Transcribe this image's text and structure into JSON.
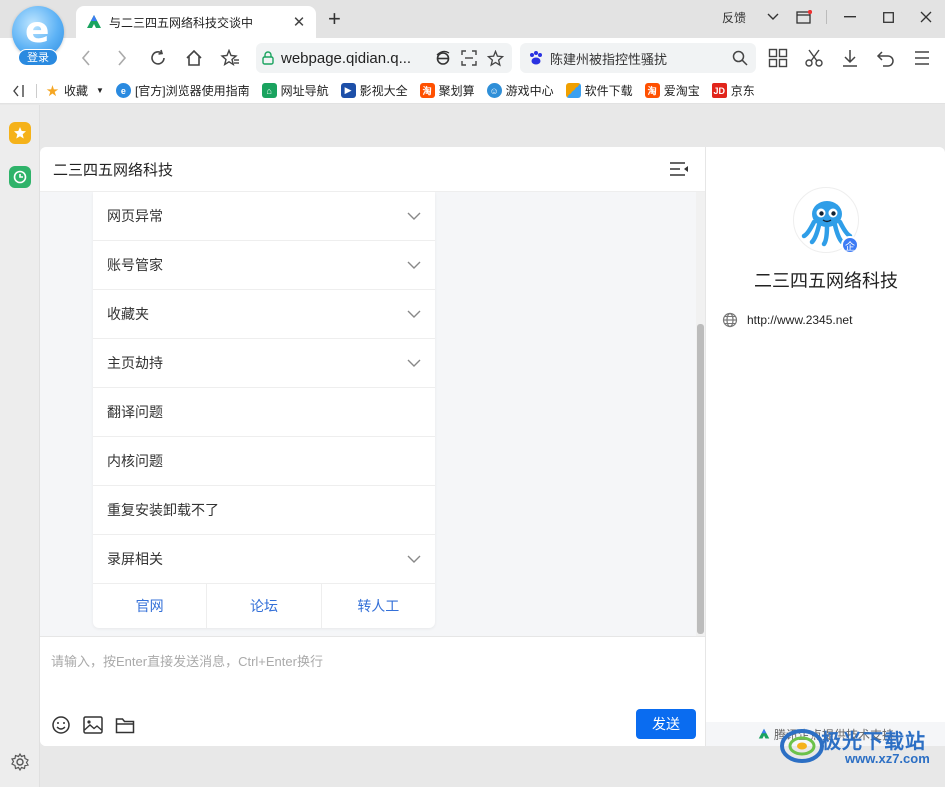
{
  "browser": {
    "login_label": "登录",
    "tab_title": "与二三四五网络科技交谈中",
    "new_tab_symbol": "+",
    "feedback_label": "反馈",
    "url": "webpage.qidian.q...",
    "search_text": "陈建州被指控性骚扰",
    "bookmarks": [
      {
        "label": "收藏",
        "icon": "star-icon",
        "color": "#f5a623"
      },
      {
        "label": "[官方]浏览器使用指南",
        "icon": "browser-icon",
        "color": "#2a8ae0"
      },
      {
        "label": "网址导航",
        "icon": "nav-2345-icon",
        "color": "#1aa35f"
      },
      {
        "label": "影视大全",
        "icon": "film-icon",
        "color": "#1d4fa8"
      },
      {
        "label": "聚划算",
        "icon": "taobao-icon",
        "color": "#ff5000"
      },
      {
        "label": "游戏中心",
        "icon": "game-icon",
        "color": "#2f8fd8"
      },
      {
        "label": "软件下载",
        "icon": "apps-icon",
        "color": "#f0a000"
      },
      {
        "label": "爱淘宝",
        "icon": "taobao-icon",
        "color": "#ff5000"
      },
      {
        "label": "京东",
        "icon": "jd-icon",
        "color": "#e1251b"
      }
    ]
  },
  "chat": {
    "title": "二三四五网络科技",
    "faq_items": [
      {
        "label": "网页异常",
        "expandable": true
      },
      {
        "label": "账号管家",
        "expandable": true
      },
      {
        "label": "收藏夹",
        "expandable": true
      },
      {
        "label": "主页劫持",
        "expandable": true
      },
      {
        "label": "翻译问题",
        "expandable": false
      },
      {
        "label": "内核问题",
        "expandable": false
      },
      {
        "label": "重复安装卸载不了",
        "expandable": false
      },
      {
        "label": "录屏相关",
        "expandable": true
      }
    ],
    "links": [
      "官网",
      "论坛",
      "转人工"
    ],
    "input_placeholder": "请输入，按Enter直接发送消息，Ctrl+Enter换行",
    "send_label": "发送"
  },
  "profile": {
    "name": "二三四五网络科技",
    "badge": "企",
    "website": "http://www.2345.net",
    "powered_by": "腾讯企点提供技术支持"
  },
  "watermark": {
    "text": "极光下载站",
    "url": "www.xz7.com"
  }
}
